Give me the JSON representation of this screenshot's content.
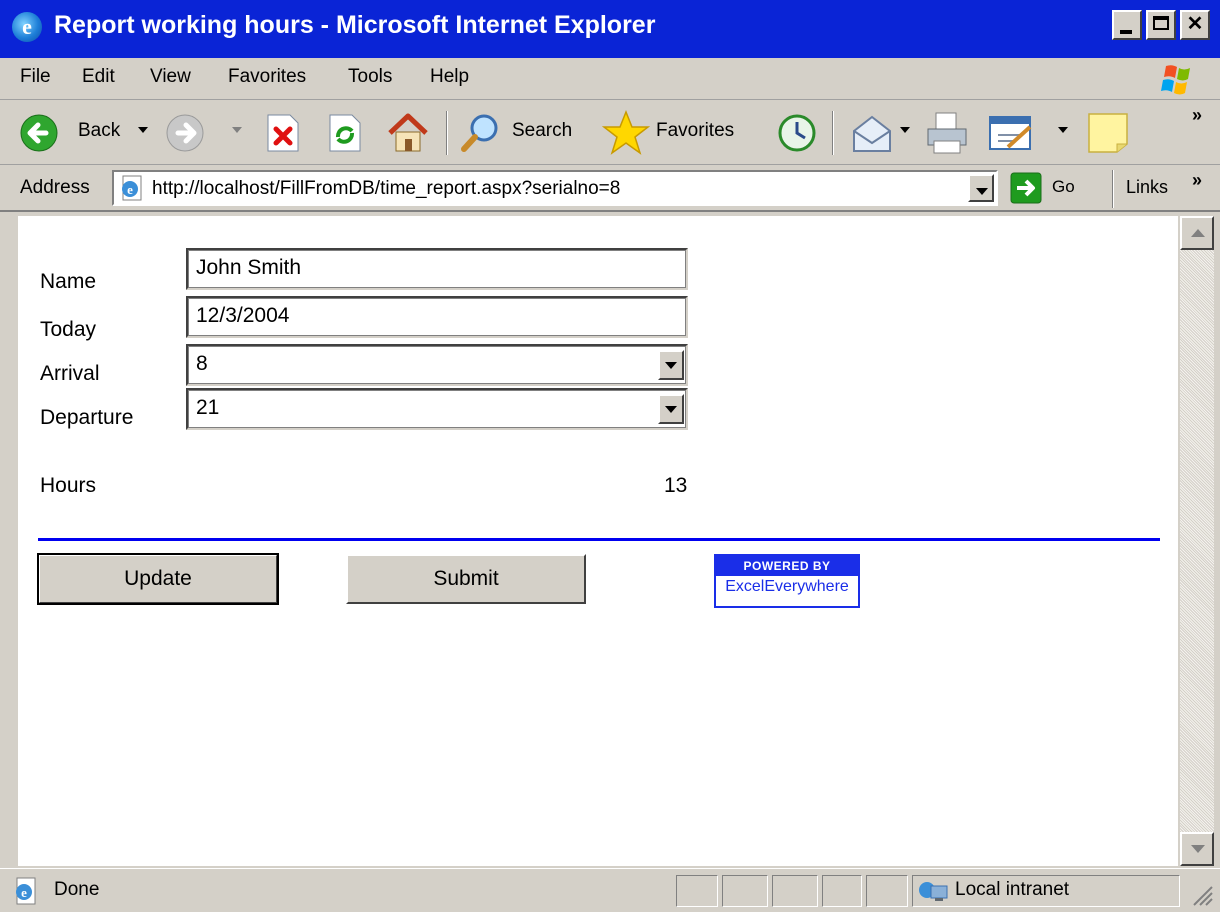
{
  "window": {
    "title": "Report working hours - Microsoft Internet Explorer"
  },
  "menu": {
    "items": [
      "File",
      "Edit",
      "View",
      "Favorites",
      "Tools",
      "Help"
    ]
  },
  "toolbar": {
    "back_label": "Back",
    "search_label": "Search",
    "favorites_label": "Favorites",
    "overflow": "»"
  },
  "address_bar": {
    "label": "Address",
    "url": "http://localhost/FillFromDB/time_report.aspx?serialno=8",
    "go_label": "Go",
    "links_label": "Links",
    "overflow": "»"
  },
  "form": {
    "name_label": "Name",
    "name_value": "John Smith",
    "today_label": "Today",
    "today_value": "12/3/2004",
    "arrival_label": "Arrival",
    "arrival_value": "8",
    "departure_label": "Departure",
    "departure_value": "21",
    "hours_label": "Hours",
    "hours_value": "13",
    "update_label": "Update",
    "submit_label": "Submit"
  },
  "badge": {
    "top": "POWERED BY",
    "bottom": "ExcelEverywhere"
  },
  "status": {
    "text": "Done",
    "zone": "Local intranet"
  },
  "colors": {
    "titlebar": "#0a24d6",
    "rule": "#0000f0",
    "badge": "#1a2ee8",
    "chrome": "#d4d0c8"
  },
  "icons": [
    "ie-icon",
    "windows-logo-icon",
    "back-icon",
    "forward-icon",
    "stop-icon",
    "refresh-icon",
    "home-icon",
    "search-icon",
    "favorites-star-icon",
    "history-icon",
    "mail-icon",
    "print-icon",
    "edit-icon",
    "note-icon",
    "page-icon",
    "go-arrow-icon",
    "intranet-icon"
  ]
}
